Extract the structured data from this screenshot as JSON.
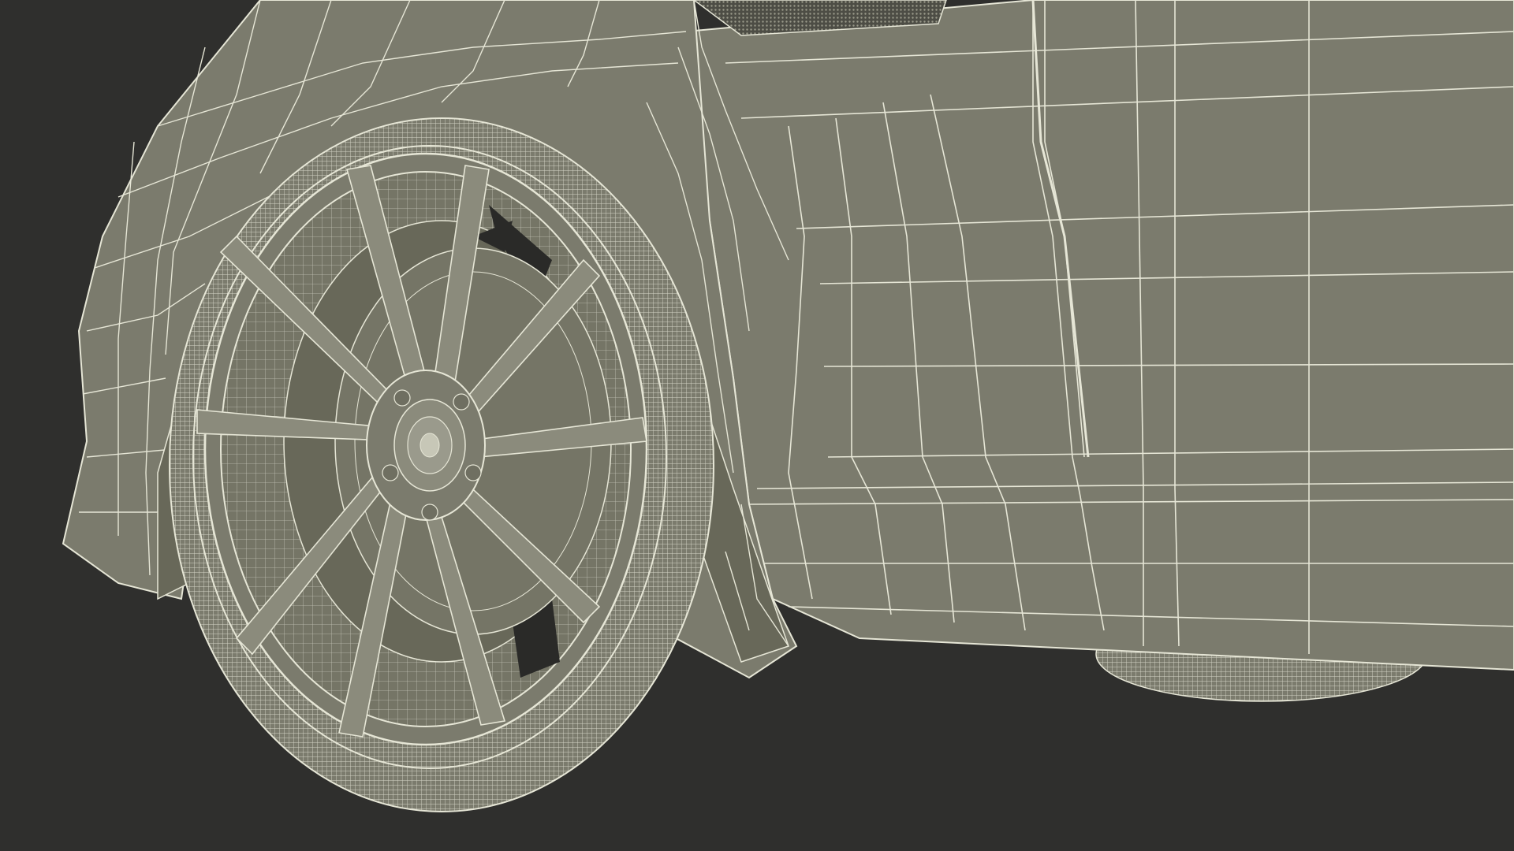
{
  "scene": {
    "subject": "car-wheel-wireframe",
    "style": "wireframe-render",
    "colors": {
      "background": "#2f2f2d",
      "surface": "#7b7b6d",
      "surface_dark": "#686859",
      "surface_light": "#8b8b7c",
      "wire": "#e6e6d6",
      "hole": "#2a2a28"
    }
  }
}
